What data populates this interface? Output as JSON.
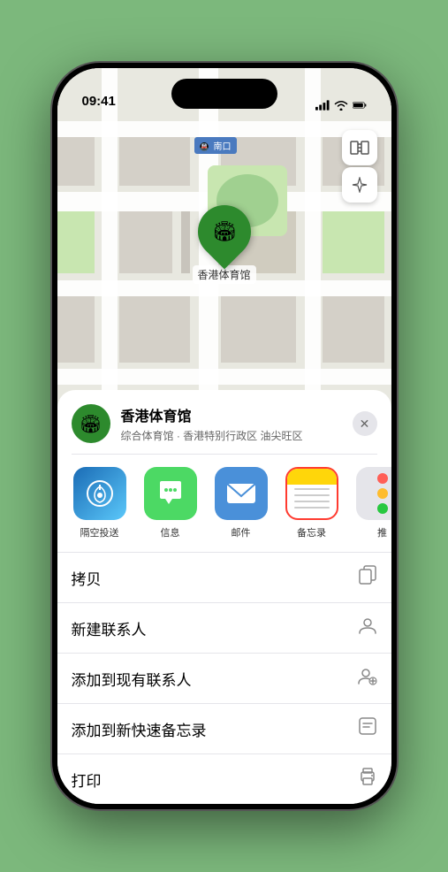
{
  "status": {
    "time": "09:41",
    "location_arrow": true
  },
  "map": {
    "south_entrance_label": "南口",
    "location_name": "香港体育馆",
    "controls": {
      "map_type": "🗺",
      "location": "↗"
    }
  },
  "place_card": {
    "name": "香港体育馆",
    "subtitle": "综合体育馆 · 香港特别行政区 油尖旺区",
    "close_label": "✕"
  },
  "share_items": [
    {
      "id": "airdrop",
      "label": "隔空投送",
      "type": "airdrop"
    },
    {
      "id": "messages",
      "label": "信息",
      "type": "messages"
    },
    {
      "id": "mail",
      "label": "邮件",
      "type": "mail"
    },
    {
      "id": "notes",
      "label": "备忘录",
      "type": "notes"
    },
    {
      "id": "more",
      "label": "推",
      "type": "more"
    }
  ],
  "actions": [
    {
      "id": "copy",
      "label": "拷贝",
      "icon": "copy"
    },
    {
      "id": "new-contact",
      "label": "新建联系人",
      "icon": "person"
    },
    {
      "id": "add-contact",
      "label": "添加到现有联系人",
      "icon": "person-add"
    },
    {
      "id": "quick-note",
      "label": "添加到新快速备忘录",
      "icon": "note"
    },
    {
      "id": "print",
      "label": "打印",
      "icon": "print"
    }
  ]
}
